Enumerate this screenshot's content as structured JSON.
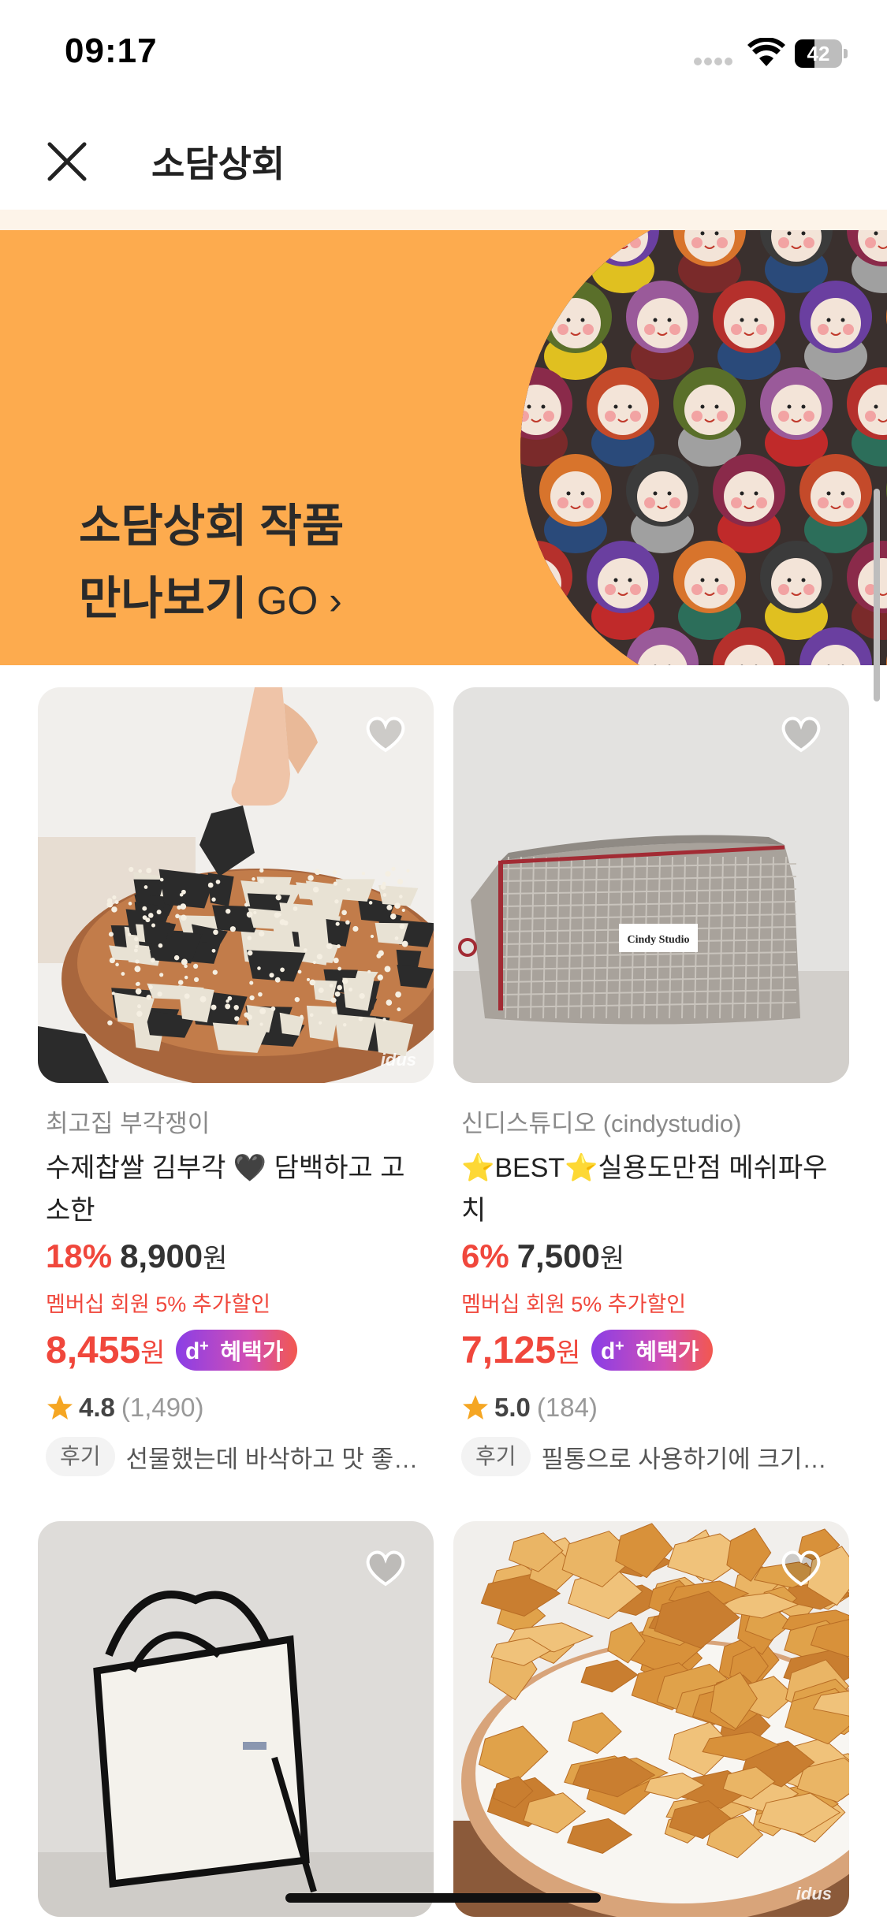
{
  "status_bar": {
    "time": "09:17",
    "battery": "42",
    "battery_level": 0.42
  },
  "header": {
    "title": "소담상회"
  },
  "banner": {
    "line1": "소담상회 작품",
    "line2": "만나보기",
    "go": "GO ›",
    "bg_color": "#fdab4e"
  },
  "products": [
    {
      "shop": "최고집 부각쟁이",
      "title": "수제찹쌀 김부각 🖤 담백하고 고소한",
      "discount": "18%",
      "price": "8,900",
      "won": "원",
      "member_note": "멤버십 회원 5% 추가할인",
      "benefit_price": "8,455",
      "benefit_won": "원",
      "benefit_label": "혜택가",
      "rating": "4.8",
      "rating_count": "(1,490)",
      "review_tag": "후기",
      "review_text": "선물했는데 바삭하고 맛 좋아요",
      "image": "seaweed-chips",
      "watermark": "idus"
    },
    {
      "shop": "신디스튜디오 (cindystudio)",
      "title": "⭐BEST⭐실용도만점 메쉬파우치",
      "discount": "6%",
      "price": "7,500",
      "won": "원",
      "member_note": "멤버십 회원 5% 추가할인",
      "benefit_price": "7,125",
      "benefit_won": "원",
      "benefit_label": "혜택가",
      "rating": "5.0",
      "rating_count": "(184)",
      "review_tag": "후기",
      "review_text": "필통으로 사용하기에 크기도 딱",
      "image": "mesh-pouch",
      "pouch_label": "Cindy Studio"
    },
    {
      "image": "canvas-tote-bag"
    },
    {
      "image": "fried-chips",
      "watermark": "idus"
    }
  ],
  "colors": {
    "accent_red": "#f0473c",
    "banner_orange": "#fdab4e"
  }
}
